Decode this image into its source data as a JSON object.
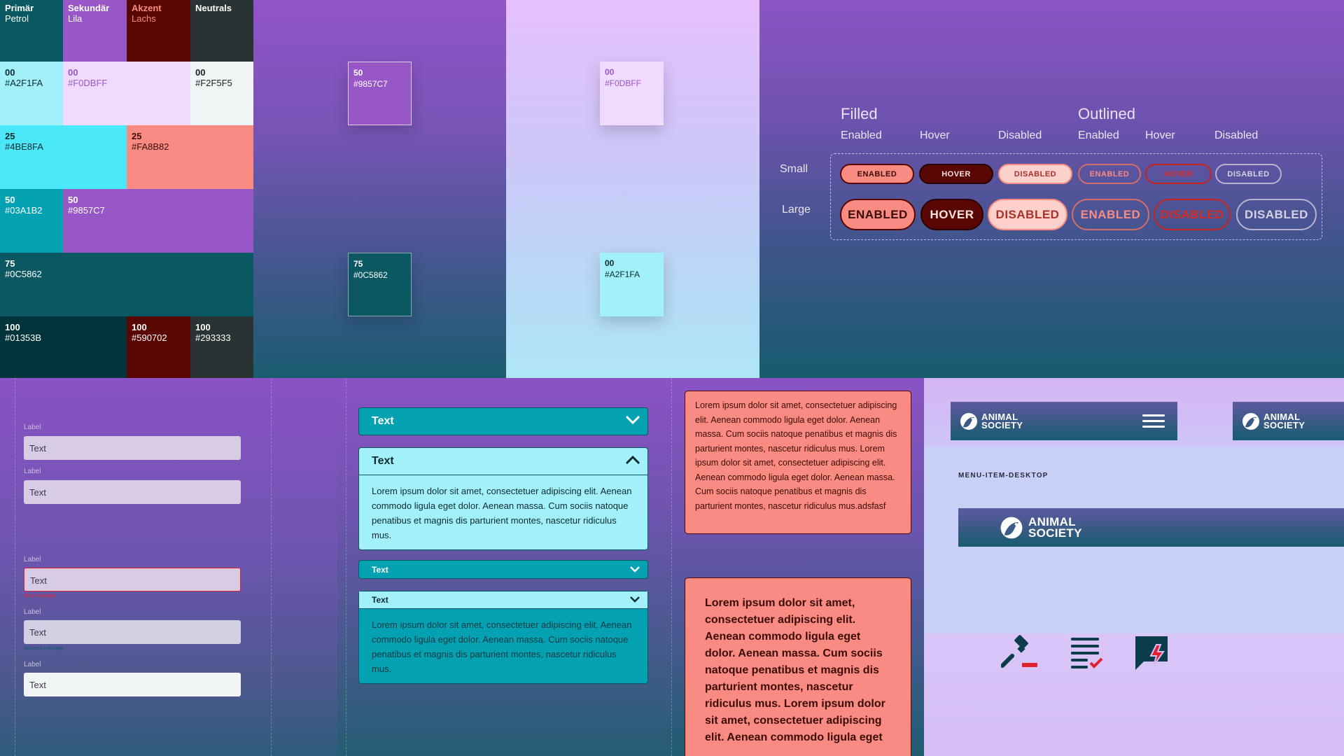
{
  "palette": {
    "headers": [
      {
        "title": "Primär",
        "sub": "Petrol"
      },
      {
        "title": "Sekundär",
        "sub": "Lila"
      },
      {
        "title": "Akzent",
        "sub": "Lachs"
      },
      {
        "title": "Neutrals",
        "sub": ""
      }
    ],
    "swatches": [
      {
        "step": "00",
        "hex": "#A2F1FA"
      },
      {
        "step": "00",
        "hex": "#F0DBFF"
      },
      {
        "step": "00",
        "hex": "#F2F5F5"
      },
      {
        "step": "25",
        "hex": "#4BE8FA"
      },
      {
        "step": "25",
        "hex": "#FA8B82"
      },
      {
        "step": "50",
        "hex": "#03A1B2"
      },
      {
        "step": "50",
        "hex": "#9857C7"
      },
      {
        "step": "75",
        "hex": "#0C5862"
      },
      {
        "step": "100",
        "hex": "#01353B"
      },
      {
        "step": "100",
        "hex": "#590702"
      },
      {
        "step": "100",
        "hex": "#293333"
      }
    ]
  },
  "on_purple": [
    {
      "step": "50",
      "hex": "#9857C7"
    },
    {
      "step": "75",
      "hex": "#0C5862"
    }
  ],
  "on_light": [
    {
      "step": "00",
      "hex": "#F0DBFF"
    },
    {
      "step": "00",
      "hex": "#A2F1FA"
    }
  ],
  "buttons": {
    "filled_title": "Filled",
    "outlined_title": "Outlined",
    "states": [
      "Enabled",
      "Hover",
      "Disabled",
      "Enabled",
      "Hover",
      "Disabled"
    ],
    "size_small": "Small",
    "size_large": "Large",
    "labels": [
      "ENABLED",
      "HOVER",
      "DISABLED",
      "ENABLED",
      "HOVER",
      "DISABLED"
    ],
    "labels_large": [
      "ENABLED",
      "HOVER",
      "DISABLED",
      "ENABLED",
      "DISABLED",
      "DISABLED"
    ]
  },
  "forms": {
    "fields": [
      {
        "label": "Label",
        "value": "Text",
        "state": "default",
        "message": ""
      },
      {
        "label": "Label",
        "value": "Text",
        "state": "default",
        "message": ""
      },
      {
        "label": "Label",
        "value": "Text",
        "state": "error",
        "message": "Error message"
      },
      {
        "label": "Label",
        "value": "Text",
        "state": "success",
        "message": "Success message"
      },
      {
        "label": "Label",
        "value": "Text",
        "state": "white",
        "message": ""
      }
    ]
  },
  "accordions": {
    "items": [
      {
        "title": "Text",
        "body": ""
      },
      {
        "title": "Text",
        "body": "Lorem ipsum dolor sit amet, consectetuer adipiscing elit. Aenean commodo ligula eget dolor. Aenean massa. Cum sociis natoque penatibus et magnis dis parturient montes, nascetur ridiculus mus."
      },
      {
        "title": "Text",
        "body": ""
      },
      {
        "title": "Text",
        "body": "Lorem ipsum dolor sit amet, consectetuer adipiscing elit. Aenean commodo ligula eget dolor. Aenean massa. Cum sociis natoque penatibus et magnis dis parturient montes, nascetur ridiculus mus."
      }
    ]
  },
  "cards": {
    "small": "Lorem ipsum dolor sit amet, consectetuer adipiscing elit. Aenean commodo ligula eget dolor. Aenean massa. Cum sociis natoque penatibus et magnis dis parturient montes, nascetur ridiculus mus. Lorem ipsum dolor sit amet, consectetuer adipiscing elit. Aenean commodo ligula eget dolor. Aenean massa. Cum sociis natoque penatibus et magnis dis parturient montes, nascetur ridiculus mus.adsfasf",
    "large": "Lorem ipsum dolor sit amet, consectetuer adipiscing elit. Aenean commodo ligula eget dolor. Aenean massa. Cum sociis natoque penatibus et magnis dis parturient montes, nascetur ridiculus mus. Lorem ipsum dolor sit amet, consectetuer adipiscing elit. Aenean commodo ligula eget"
  },
  "brand": {
    "logo_line1": "ANIMAL",
    "logo_line2": "SOCIETY",
    "menu_label": "MENU-ITEM-DESKTOP",
    "icons": [
      "gavel-icon",
      "checklist-icon",
      "chat-alert-icon"
    ]
  },
  "colors": {
    "petrol_00": "#A2F1FA",
    "petrol_25": "#4BE8FA",
    "petrol_50": "#03A1B2",
    "petrol_75": "#0C5862",
    "petrol_100": "#01353B",
    "lila_00": "#F0DBFF",
    "lila_50": "#9857C7",
    "lachs_25": "#FA8B82",
    "lachs_100": "#590702",
    "neutral_00": "#F2F5F5",
    "neutral_100": "#293333"
  }
}
